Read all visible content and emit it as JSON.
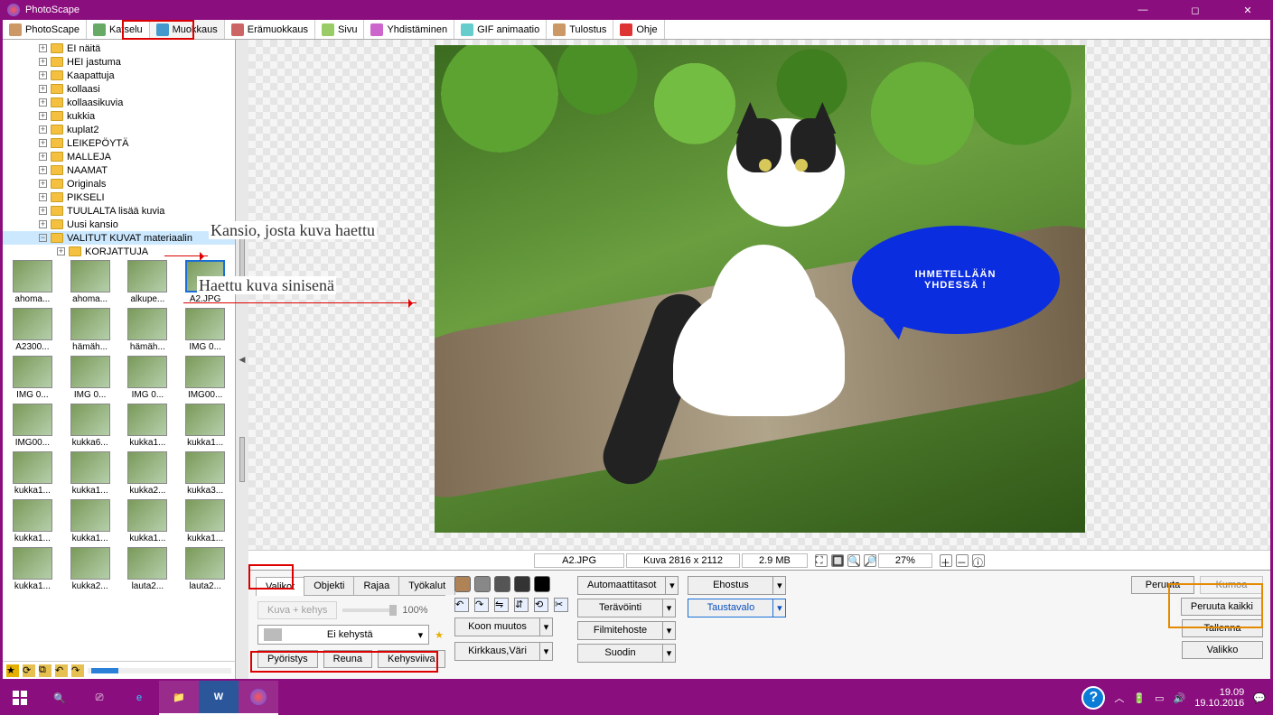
{
  "window": {
    "title": "PhotoScape"
  },
  "maintabs": [
    {
      "label": "PhotoScape",
      "icon": "#c96"
    },
    {
      "label": "Katselu",
      "icon": "#6a6"
    },
    {
      "label": "Muokkaus",
      "icon": "#49c",
      "active": true
    },
    {
      "label": "Erämuokkaus",
      "icon": "#c66"
    },
    {
      "label": "Sivu",
      "icon": "#9c6"
    },
    {
      "label": "Yhdistäminen",
      "icon": "#c6c"
    },
    {
      "label": "GIF animaatio",
      "icon": "#6cc"
    },
    {
      "label": "Tulostus",
      "icon": "#c96"
    },
    {
      "label": "Ohje",
      "icon": "#d33"
    }
  ],
  "tree": [
    {
      "label": "EI näitä"
    },
    {
      "label": "HEI jastuma"
    },
    {
      "label": "Kaapattuja"
    },
    {
      "label": "kollaasi"
    },
    {
      "label": "kollaasikuvia"
    },
    {
      "label": "kukkia"
    },
    {
      "label": "kuplat2"
    },
    {
      "label": "LEIKEPÖYTÄ"
    },
    {
      "label": "MALLEJA"
    },
    {
      "label": "NAAMAT"
    },
    {
      "label": "Originals"
    },
    {
      "label": "PIKSELI"
    },
    {
      "label": "TUULALTA lisää kuvia"
    },
    {
      "label": "Uusi kansio"
    },
    {
      "label": "VALITUT KUVAT materiaalin",
      "selected": true,
      "expanded": true
    },
    {
      "label": "KORJATTUJA",
      "child": true
    }
  ],
  "thumbs": [
    {
      "label": "ahoma..."
    },
    {
      "label": "ahoma..."
    },
    {
      "label": "alkupe..."
    },
    {
      "label": "A2.JPG",
      "selected": true
    },
    {
      "label": "A2300..."
    },
    {
      "label": "hämäh..."
    },
    {
      "label": "hämäh..."
    },
    {
      "label": "IMG 0..."
    },
    {
      "label": "IMG 0..."
    },
    {
      "label": "IMG 0..."
    },
    {
      "label": "IMG 0..."
    },
    {
      "label": "IMG00..."
    },
    {
      "label": "IMG00..."
    },
    {
      "label": "kukka6..."
    },
    {
      "label": "kukka1..."
    },
    {
      "label": "kukka1..."
    },
    {
      "label": "kukka1..."
    },
    {
      "label": "kukka1..."
    },
    {
      "label": "kukka2..."
    },
    {
      "label": "kukka3..."
    },
    {
      "label": "kukka1..."
    },
    {
      "label": "kukka1..."
    },
    {
      "label": "kukka1..."
    },
    {
      "label": "kukka1..."
    },
    {
      "label": "kukka1..."
    },
    {
      "label": "kukka2..."
    },
    {
      "label": "lauta2..."
    },
    {
      "label": "lauta2..."
    }
  ],
  "annotations": {
    "folder_note": "Kansio, josta kuva haettu",
    "thumb_note": "Haettu kuva sinisenä"
  },
  "bubble": {
    "line1": "IHMETELLÄÄN",
    "line2": "YHDESSÄ !"
  },
  "infobar": {
    "filename": "A2.JPG",
    "dims": "Kuva 2816 x 2112",
    "size": "2.9 MB",
    "zoom": "27%"
  },
  "tooltabs": [
    {
      "label": "Valikot",
      "active": true
    },
    {
      "label": "Objekti"
    },
    {
      "label": "Rajaa"
    },
    {
      "label": "Työkalut"
    }
  ],
  "valikot": {
    "kuva_kehys": "Kuva + kehys",
    "zoom100": "100%",
    "frame_select": "Ei kehystä",
    "buttons": [
      "Pyöristys",
      "Reuna",
      "Kehysviiva"
    ]
  },
  "dropcol1": [
    {
      "label": "Automaattitasot"
    },
    {
      "label": "Terävöinti"
    },
    {
      "label": "Filmitehoste"
    },
    {
      "label": "Suodin"
    }
  ],
  "dropcol2": [
    {
      "label": "Ehostus"
    },
    {
      "label": "Taustavalo",
      "selected": true
    }
  ],
  "midbtns": {
    "koon_muutos": "Koon muutos",
    "kirkkaus": "Kirkkaus,Väri"
  },
  "rightbtns": {
    "peruuta": "Peruuta",
    "kumoa": "Kumoa",
    "peruuta_kaikki": "Peruuta kaikki",
    "tallenna": "Tallenna",
    "valikko": "Valikko"
  },
  "taskbar": {
    "time": "19.09",
    "date": "19.10.2016"
  }
}
